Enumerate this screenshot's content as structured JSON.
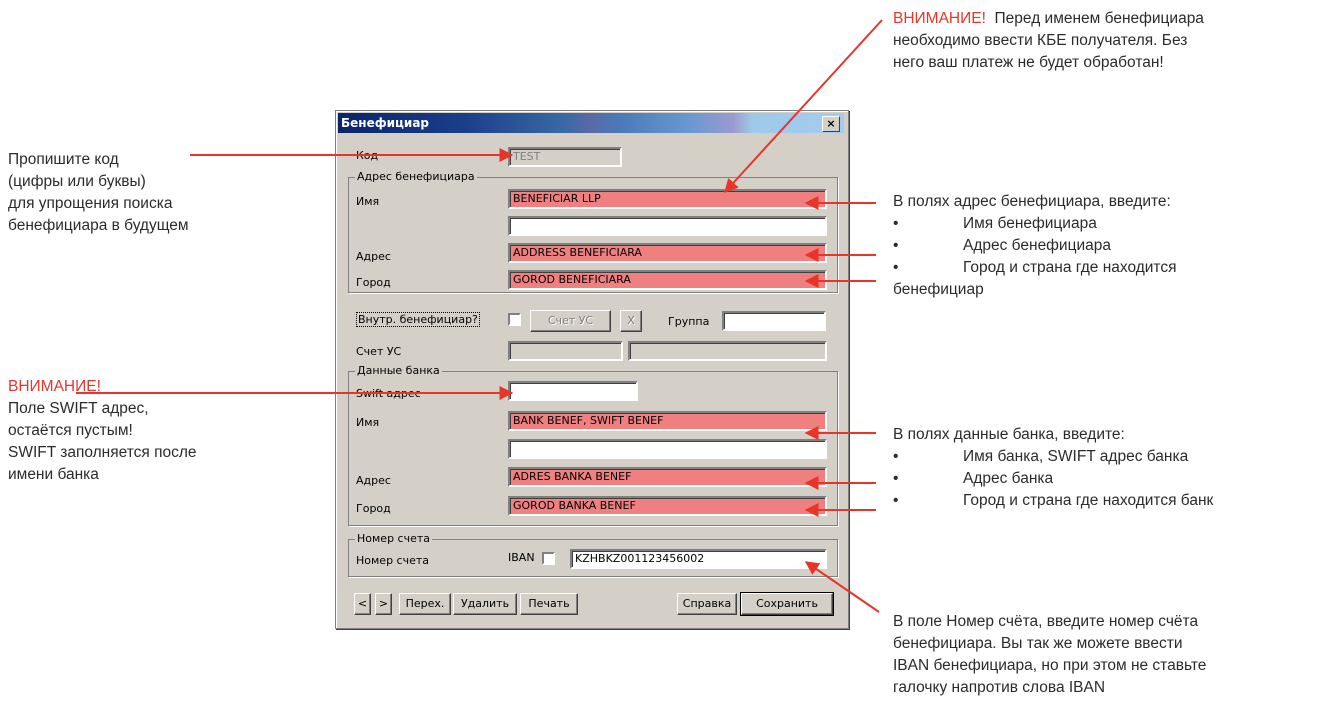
{
  "annotations": {
    "top_warning": "ВНИМАНИЕ!",
    "top_text_1": "Перед именем бенефициара",
    "top_text_2": "необходимо ввести КБЕ получателя. Без",
    "top_text_3": "него ваш платеж не будет обработан!",
    "code_1": "Пропишите код",
    "code_2": "(цифры или буквы)",
    "code_3": "для упрощения поиска",
    "code_4": "бенефициара в будущем",
    "addr_intro": "В полях адрес бенефициара, введите:",
    "addr_items": [
      "Имя бенефициара",
      "Адрес бенефициара",
      "Город и страна где находится"
    ],
    "addr_tail": "бенефициар",
    "swift_warning": "ВНИМАНИЕ!",
    "swift_1": "Поле SWIFT адрес,",
    "swift_2": "остаётся пустым!",
    "swift_3": "SWIFT заполняется после",
    "swift_4": "имени банка",
    "bank_intro": "В полях данные банка, введите:",
    "bank_items": [
      "Имя банка, SWIFT адрес банка",
      "Адрес банка",
      "Город и страна где находится банк"
    ],
    "acct_1": "В поле Номер счёта, введите номер счёта",
    "acct_2": "бенефициара. Вы так же можете ввести",
    "acct_3": "IBAN бенефициара, но при этом не ставьте",
    "acct_4": "галочку напротив слова  IBAN",
    "bullet": "•"
  },
  "dialog": {
    "title": "Бенефициар",
    "close": "×",
    "code_label": "Код",
    "code_value": "TEST",
    "address_group": "Адрес бенефициара",
    "name_label": "Имя",
    "name_value": "BENEFICIAR LLP",
    "name_value_2": "",
    "address_label": "Адрес",
    "address_value": "ADDRESS BENEFICIARA",
    "city_label": "Город",
    "city_value": "GOROD BENEFICIARA",
    "internal_label": "Внутр. бенефициар?",
    "uc_account_btn": "Счет УС",
    "x_btn": "X",
    "group_label": "Группа",
    "group_value": "",
    "uc_account_label": "Счет УС",
    "bank_group": "Данные банка",
    "swift_label": "Swift адрес",
    "swift_value": "",
    "bank_name_label": "Имя",
    "bank_name_value": "BANK BENEF, SWIFT BENEF",
    "bank_name_value_2": "",
    "bank_address_label": "Адрес",
    "bank_address_value": "ADRES BANKA BENEF",
    "bank_city_label": "Город",
    "bank_city_value": "GOROD BANKA BENEF",
    "account_group": "Номер счета",
    "account_label": "Номер счета",
    "iban_label": "IBAN",
    "account_value": "KZHBKZ001123456002",
    "buttons": {
      "prev": "<",
      "next": ">",
      "goto": "Перех.",
      "delete": "Удалить",
      "print": "Печать",
      "help": "Справка",
      "save": "Сохранить"
    }
  }
}
